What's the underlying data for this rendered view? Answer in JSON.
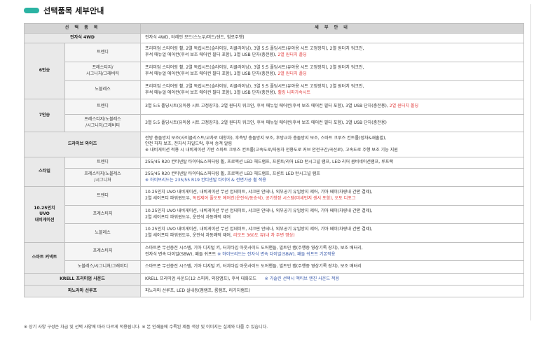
{
  "title": "선택품목 세부안내",
  "headers": {
    "item": "선 택 품 목",
    "detail": "세 부 안 내"
  },
  "rows": {
    "awd": {
      "group": "전자식 4WD",
      "desc": "전자식 4WD, 터레인 모드(스노우/머드/샌드, 험로주행)"
    },
    "six": {
      "group": "6인승",
      "trendy": {
        "sub": "트렌디",
        "l1": "프리미엄 스티어링 휠, 2열 독립시트(슬라이딩, 리클라이닝), 3열 5:5 폴딩시트(유아용 시트 고정장치), 2열 원터치 워크인,",
        "l2": "후석 매뉴얼 에어컨(후석 보조 에어컨 필터 포함), 3열 USB 단자(충전용), ",
        "l2_red": "2열 원터치 폴딩"
      },
      "prestige": {
        "sub1": "프레스티지/",
        "sub2": "시그니처/그래비티",
        "l1": "프리미엄 스티어링 휠, 2열 독립시트(슬라이딩, 리클라이닝), 3열 5:5 폴딩시트(유아용 시트 고정장치), 2열 원터치 워크인,",
        "l2": "후석 매뉴얼 에어컨(후석 보조 에어컨 필터 포함), 3열 USB 단자(충전용), ",
        "l2_red": "2열 원터치 폴딩"
      },
      "noblesse": {
        "sub": "노블레스",
        "l1": "프리미엄 스티어링 휠, 2열 독립시트(슬라이딩, 리클라이닝), 3열 5:5 폴딩시트(유아용 시트 고정장치), 2열 원터치 워크인,",
        "l2": "후석 매뉴얼 에어컨(후석 보조 에어컨 필터 포함), 3열 USB 단자(충전용), ",
        "l2_red": "휠링 니퍼가속시트"
      }
    },
    "seven": {
      "group": "7인승",
      "trendy": {
        "sub": "트렌디",
        "text": "3열 5:5 폴딩시트(유아용 시트 고정장치), 2열 원터치 워크인, 후석 매뉴얼 에어컨(후석 보조 에어컨 필터 포함), 3열 USB 단자(충전용), ",
        "red": "2열 원터치 폴딩"
      },
      "prestige": {
        "sub1": "프레스티지/노블레스",
        "sub2": "/시그니처/그래비티",
        "text": "3열 5:5 폴딩시트(유아용 시트 고정장치), 2열 원터치 워크인, 후석 매뉴얼 에어컨(후석 보조 에어컨 필터 포함), 3열 USB 단자(충전용)"
      }
    },
    "drivewise": {
      "group": "드라이브 와이즈",
      "l1": "전방 충돌방지 보조(사이클리스트/교차로 대향차), 후측방 충돌방지 보조, 후방교차 충돌방지 보조, 스마트 크루즈 컨트롤(정차&재출발),",
      "l2": "안전 하차 보조, 전자식 차일드락, 후석 승객 알림",
      "l3": "※ 내비게이션 적용 시 내비게이션 기반 스마트 크루즈 컨트롤(고속도로/자동차 전용도로 커브 안전구간/곡선로), 고속도로 주행 보조 기능 지원"
    },
    "style": {
      "group": "스타일",
      "trendy": {
        "sub": "트렌디",
        "text": "255/45 R20 컨티넨탈 타이어&스퍼터링 휠, 프로젝션 LED 헤드램프, 프론트/리어 LED 턴시그널 램프, LED 리어 콤비네이션램프, 루프랙"
      },
      "prestige": {
        "sub1": "프레스티지/노블레스",
        "sub2": "/시그니처",
        "l1": "255/45 R20 컨티넨탈 타이어&스퍼터링 휠, 프로젝션 LED 헤드램프, 프론트 LED 턴시그널 램프",
        "l2": "※ 하이브리드는 235/55 R19 컨티넨탈 타이어 & 전면가공 휠 적용"
      }
    },
    "navi": {
      "g1": "10.25인치",
      "g2": "UVO",
      "g3": "내비게이션",
      "trendy": {
        "sub": "트렌디",
        "l1": "10.25인치 UVO 내비게이션, 내비게이션 무선 업데이트, 샤크핀 안테나, 외부공기 유입방지 제어, 기아 페이(차량내 간편 결제),",
        "l2": "2열 세이프티 파워윈도우, ",
        "l2_red": "독립제어 풀오토 에어컨(운전석/동승석), 공기청정 시스템(미세먼지 센서 포함), 오토 디포그"
      },
      "prestige": {
        "sub": "프레스티지",
        "l1": "10.25인치 UVO 내비게이션, 내비게이션 무선 업데이트, 샤크핀 안테나, 외부공기 유입방지 제어, 기아 페이(차량내 간편 결제),",
        "l2": "2열 세이프티 파워윈도우, 운전석 자동쾌적 제어"
      },
      "noblesse": {
        "sub": "노블레스",
        "l1": "10.25인치 UVO 내비게이션, 내비게이션 무선 업데이트, 샤크핀 안테나, 외부공기 유입방지 제어, 기아 페이(차량내 간편 결제),",
        "l2": "2열 세이프티 파워윈도우, 운전석 자동쾌적 제어, ",
        "l2_red": "리모트 360도 뷰(내 차 주변 영상)"
      }
    },
    "smart": {
      "group": "스마트 커넥트",
      "prestige": {
        "sub": "프레스티지",
        "l1": "스마트폰 무선충전 시스템, 기아 디지털 키, 터치타입 아웃사이드 도어핸들, 빌트인 캠(주행중 영상기록 장치), 보조 배터리,",
        "l2": "전자식 변속 다이얼(SBW), 패들 쉬프트  ",
        "l2_blue": "※ 하이브리드는 전자식 변속 다이얼(SBW), 패들 쉬프트 기본적용"
      },
      "noblesse": {
        "sub": "노블레스/시그니처/그래비티",
        "text": "스마트폰 무선충전 시스템, 기아 디지털 키, 터치타입 아웃사이드 도어핸들, 빌트인 캠(주행중 영상기록 장치), 보조 배터리"
      }
    },
    "krell": {
      "group": "KRELL 프리미엄 사운드",
      "text": "KRELL 프리미엄 사운드(12 스피커, 외장앰프), 후석 대화모드",
      "blue": "※ 가솔린 선택시 액티브 엔진 사운드 적용"
    },
    "panorama": {
      "group": "파노라마 선루프",
      "text": "파노라마 선루프, LED 실내등(맵램프, 룸램프, 러기지램프)"
    }
  },
  "footnote": "※ 상기 사양 구성은 차급 및 선택 사양에 따라 다르게 적용됩니다.  ※ 본 인쇄물에 수록된 제품 색상 및 이미지는 실제와 다를 수 있습니다."
}
